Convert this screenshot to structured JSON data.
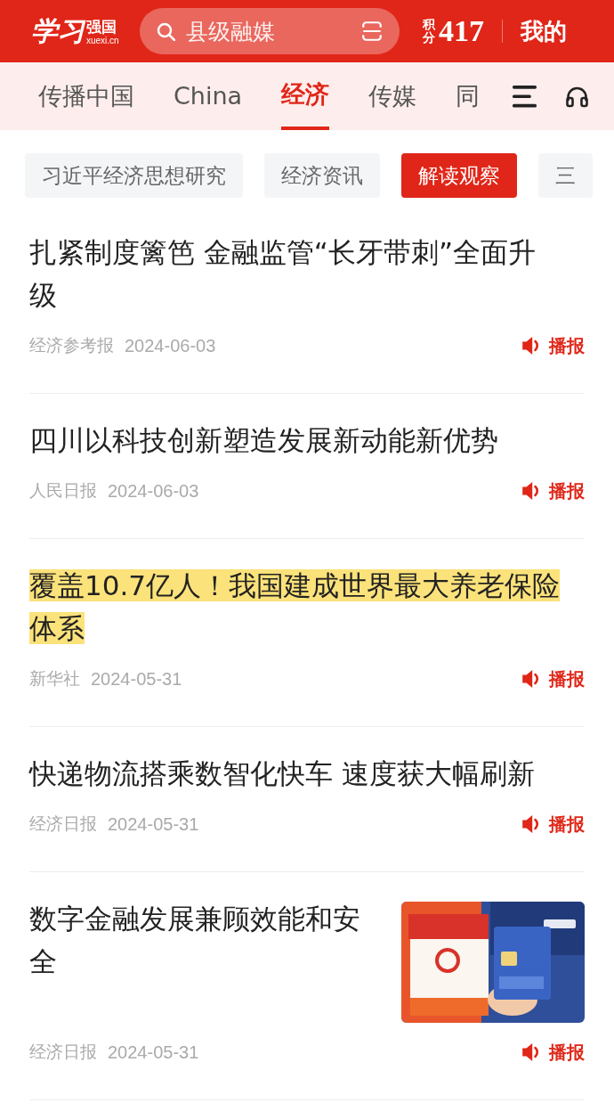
{
  "header": {
    "logo": {
      "calligraphy": "学习",
      "name": "强国",
      "domain": "xuexi.cn"
    },
    "search": {
      "placeholder": "县级融媒"
    },
    "points": {
      "label": "积分",
      "value": "417"
    },
    "profile": "我的"
  },
  "tabs": [
    {
      "label": "传播中国",
      "selected": false
    },
    {
      "label": "China",
      "selected": false
    },
    {
      "label": "经济",
      "selected": true
    },
    {
      "label": "传媒",
      "selected": false
    },
    {
      "label": "同",
      "selected": false
    }
  ],
  "chips": [
    {
      "label": "习近平经济思想研究",
      "selected": false
    },
    {
      "label": "经济资讯",
      "selected": false
    },
    {
      "label": "解读观察",
      "selected": true
    },
    {
      "label": "三",
      "selected": false
    }
  ],
  "articles": [
    {
      "title": "扎紧制度篱笆 金融监管“长牙带刺”全面升级",
      "source": "经济参考报",
      "date": "2024-06-03",
      "action": "播报",
      "highlighted": false
    },
    {
      "title": "四川以科技创新塑造发展新动能新优势",
      "source": "人民日报",
      "date": "2024-06-03",
      "action": "播报",
      "highlighted": false
    },
    {
      "title": "覆盖10.7亿人！我国建成世界最大养老保险体系",
      "source": "新华社",
      "date": "2024-05-31",
      "action": "播报",
      "highlighted": true
    },
    {
      "title": "快递物流搭乘数智化快车 速度获大幅刷新",
      "source": "经济日报",
      "date": "2024-05-31",
      "action": "播报",
      "highlighted": false
    },
    {
      "title": "数字金融发展兼顾效能和安全",
      "source": "经济日报",
      "date": "2024-05-31",
      "action": "播报",
      "highlighted": false
    }
  ]
}
